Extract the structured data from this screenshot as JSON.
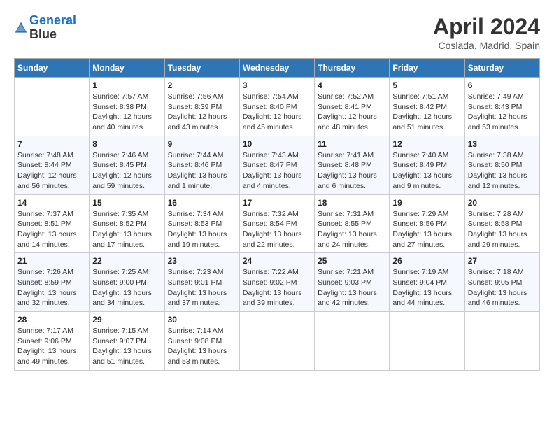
{
  "header": {
    "logo_line1": "General",
    "logo_line2": "Blue",
    "main_title": "April 2024",
    "subtitle": "Coslada, Madrid, Spain"
  },
  "days_of_week": [
    "Sunday",
    "Monday",
    "Tuesday",
    "Wednesday",
    "Thursday",
    "Friday",
    "Saturday"
  ],
  "weeks": [
    [
      {
        "day": "",
        "info": ""
      },
      {
        "day": "1",
        "info": "Sunrise: 7:57 AM\nSunset: 8:38 PM\nDaylight: 12 hours\nand 40 minutes."
      },
      {
        "day": "2",
        "info": "Sunrise: 7:56 AM\nSunset: 8:39 PM\nDaylight: 12 hours\nand 43 minutes."
      },
      {
        "day": "3",
        "info": "Sunrise: 7:54 AM\nSunset: 8:40 PM\nDaylight: 12 hours\nand 45 minutes."
      },
      {
        "day": "4",
        "info": "Sunrise: 7:52 AM\nSunset: 8:41 PM\nDaylight: 12 hours\nand 48 minutes."
      },
      {
        "day": "5",
        "info": "Sunrise: 7:51 AM\nSunset: 8:42 PM\nDaylight: 12 hours\nand 51 minutes."
      },
      {
        "day": "6",
        "info": "Sunrise: 7:49 AM\nSunset: 8:43 PM\nDaylight: 12 hours\nand 53 minutes."
      }
    ],
    [
      {
        "day": "7",
        "info": "Sunrise: 7:48 AM\nSunset: 8:44 PM\nDaylight: 12 hours\nand 56 minutes."
      },
      {
        "day": "8",
        "info": "Sunrise: 7:46 AM\nSunset: 8:45 PM\nDaylight: 12 hours\nand 59 minutes."
      },
      {
        "day": "9",
        "info": "Sunrise: 7:44 AM\nSunset: 8:46 PM\nDaylight: 13 hours\nand 1 minute."
      },
      {
        "day": "10",
        "info": "Sunrise: 7:43 AM\nSunset: 8:47 PM\nDaylight: 13 hours\nand 4 minutes."
      },
      {
        "day": "11",
        "info": "Sunrise: 7:41 AM\nSunset: 8:48 PM\nDaylight: 13 hours\nand 6 minutes."
      },
      {
        "day": "12",
        "info": "Sunrise: 7:40 AM\nSunset: 8:49 PM\nDaylight: 13 hours\nand 9 minutes."
      },
      {
        "day": "13",
        "info": "Sunrise: 7:38 AM\nSunset: 8:50 PM\nDaylight: 13 hours\nand 12 minutes."
      }
    ],
    [
      {
        "day": "14",
        "info": "Sunrise: 7:37 AM\nSunset: 8:51 PM\nDaylight: 13 hours\nand 14 minutes."
      },
      {
        "day": "15",
        "info": "Sunrise: 7:35 AM\nSunset: 8:52 PM\nDaylight: 13 hours\nand 17 minutes."
      },
      {
        "day": "16",
        "info": "Sunrise: 7:34 AM\nSunset: 8:53 PM\nDaylight: 13 hours\nand 19 minutes."
      },
      {
        "day": "17",
        "info": "Sunrise: 7:32 AM\nSunset: 8:54 PM\nDaylight: 13 hours\nand 22 minutes."
      },
      {
        "day": "18",
        "info": "Sunrise: 7:31 AM\nSunset: 8:55 PM\nDaylight: 13 hours\nand 24 minutes."
      },
      {
        "day": "19",
        "info": "Sunrise: 7:29 AM\nSunset: 8:56 PM\nDaylight: 13 hours\nand 27 minutes."
      },
      {
        "day": "20",
        "info": "Sunrise: 7:28 AM\nSunset: 8:58 PM\nDaylight: 13 hours\nand 29 minutes."
      }
    ],
    [
      {
        "day": "21",
        "info": "Sunrise: 7:26 AM\nSunset: 8:59 PM\nDaylight: 13 hours\nand 32 minutes."
      },
      {
        "day": "22",
        "info": "Sunrise: 7:25 AM\nSunset: 9:00 PM\nDaylight: 13 hours\nand 34 minutes."
      },
      {
        "day": "23",
        "info": "Sunrise: 7:23 AM\nSunset: 9:01 PM\nDaylight: 13 hours\nand 37 minutes."
      },
      {
        "day": "24",
        "info": "Sunrise: 7:22 AM\nSunset: 9:02 PM\nDaylight: 13 hours\nand 39 minutes."
      },
      {
        "day": "25",
        "info": "Sunrise: 7:21 AM\nSunset: 9:03 PM\nDaylight: 13 hours\nand 42 minutes."
      },
      {
        "day": "26",
        "info": "Sunrise: 7:19 AM\nSunset: 9:04 PM\nDaylight: 13 hours\nand 44 minutes."
      },
      {
        "day": "27",
        "info": "Sunrise: 7:18 AM\nSunset: 9:05 PM\nDaylight: 13 hours\nand 46 minutes."
      }
    ],
    [
      {
        "day": "28",
        "info": "Sunrise: 7:17 AM\nSunset: 9:06 PM\nDaylight: 13 hours\nand 49 minutes."
      },
      {
        "day": "29",
        "info": "Sunrise: 7:15 AM\nSunset: 9:07 PM\nDaylight: 13 hours\nand 51 minutes."
      },
      {
        "day": "30",
        "info": "Sunrise: 7:14 AM\nSunset: 9:08 PM\nDaylight: 13 hours\nand 53 minutes."
      },
      {
        "day": "",
        "info": ""
      },
      {
        "day": "",
        "info": ""
      },
      {
        "day": "",
        "info": ""
      },
      {
        "day": "",
        "info": ""
      }
    ]
  ]
}
